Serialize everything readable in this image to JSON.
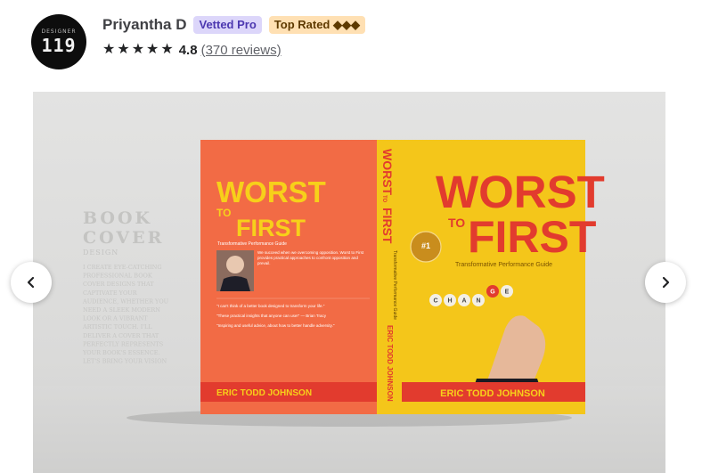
{
  "seller": {
    "avatar_small": "DESIGNER",
    "avatar_big": "119",
    "name": "Priyantha D",
    "badge_vetted": "Vetted Pro",
    "badge_top": "Top Rated ◆◆◆",
    "star_glyph": "★",
    "rating": "4.8",
    "reviews": "(370 reviews)"
  },
  "gallery": {
    "side_heading_1": "BOOK",
    "side_heading_2": "COVER",
    "side_heading_3": "DESIGN",
    "side_blurb": [
      "I CREATE EYE-CATCHING",
      "PROFESSIONAL BOOK",
      "COVER DESIGNS THAT",
      "CAPTIVATE YOUR",
      "AUDIENCE, WHETHER YOU",
      "NEED A SLEEK MODERN",
      "LOOK OR A VIBRANT",
      "ARTISTIC TOUCH. I'LL",
      "DELIVER A COVER THAT",
      "PERFECTLY REPRESENTS",
      "YOUR BOOK'S ESSENCE.",
      "LET'S BRING YOUR VISION"
    ],
    "book": {
      "title_1": "WORST",
      "title_to": "TO",
      "title_2": "FIRST",
      "subtitle": "Transformative Performance Guide",
      "author": "ERIC TODD JOHNSON",
      "change_word": "CHANGE",
      "seal_mark": "#1",
      "back_blurb": "We succeed when we overcoming opposition. Worst to First provides practical approaches to confront opposition and prevail.",
      "back_quote_1": "\"I can't think of a better book designed to transform your life.\"",
      "back_quote_2": "\"These practical insights that anyone can use!\" — Brian Tracy",
      "back_quote_3": "\"Inspiring and useful advice, about how to better handle adversity.\""
    }
  },
  "nav": {
    "prev_label": "Previous",
    "next_label": "Next"
  }
}
